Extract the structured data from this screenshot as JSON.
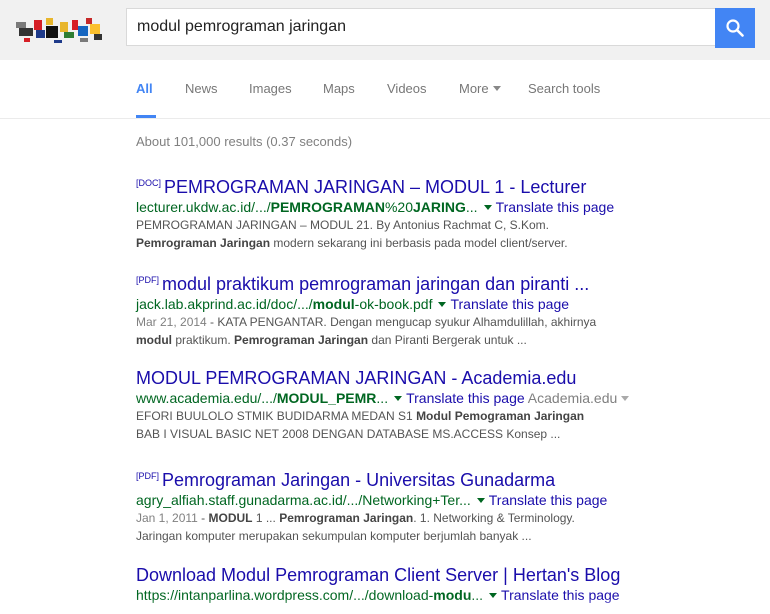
{
  "search": {
    "query": "modul pemrograman jaringan"
  },
  "tabs": [
    {
      "label": "All",
      "active": true
    },
    {
      "label": "News"
    },
    {
      "label": "Images"
    },
    {
      "label": "Maps"
    },
    {
      "label": "Videos"
    },
    {
      "label": "More"
    },
    {
      "label": "Search tools"
    }
  ],
  "stats": "About 101,000 results (0.37 seconds)",
  "translate_label": "Translate this page",
  "results": [
    {
      "filetype": "[DOC]",
      "title": "PEMROGRAMAN JARINGAN – MODUL 1 - Lecturer",
      "url_pre": "lecturer.ukdw.ac.id/.../",
      "url_bold": "PEMROGRAMAN",
      "url_mid": "%20",
      "url_bold2": "JARING",
      "url_post": "...",
      "snippet1": "PEMROGRAMAN JARINGAN – MODUL 21. By Antonius Rachmat C, S.Kom.",
      "snippet2_bold": "Pemrograman Jaringan",
      "snippet2_rest": " modern sekarang ini berbasis pada model client/server."
    },
    {
      "filetype": "[PDF]",
      "title": "modul praktikum pemrograman jaringan dan piranti ...",
      "url_pre": "jack.lab.akprind.ac.id/doc/.../",
      "url_bold": "modul",
      "url_post": "-ok-book.pdf",
      "date": "Mar 21, 2014",
      "snippet1_rest": " - KATA PENGANTAR. Dengan mengucap syukur Alhamdulillah, akhirnya",
      "snippet2_bold": "modul",
      "snippet2_mid": " praktikum. ",
      "snippet2_bold2": "Pemrograman Jaringan",
      "snippet2_rest": " dan Piranti Bergerak untuk ..."
    },
    {
      "title": "MODUL PEMROGRAMAN JARINGAN - Academia.edu",
      "url_pre": "www.academia.edu/.../",
      "url_bold": "MODUL_PEMR",
      "url_post": "...",
      "source": "Academia.edu",
      "snippet1_pre": "EFORI BUULOLO STMIK BUDIDARMA MEDAN S1 ",
      "snippet1_bold": "Modul Pemograman Jaringan",
      "snippet2": "BAB I VISUAL BASIC NET 2008 DENGAN DATABASE MS.ACCESS Konsep ..."
    },
    {
      "filetype": "[PDF]",
      "title": "Pemrograman Jaringan - Universitas Gunadarma",
      "url_pre": "agry_alfiah.staff.gunadarma.ac.id/.../Networking+Ter...",
      "date": "Jan 1, 2011",
      "snippet1_mid": " - ",
      "snippet1_bold": "MODUL",
      "snippet1_mid2": " 1 ... ",
      "snippet1_bold2": "Pemrograman Jaringan",
      "snippet1_rest": ". 1. Networking & Terminology.",
      "snippet2": "Jaringan komputer merupakan sekumpulan komputer berjumlah banyak ..."
    },
    {
      "title": "Download Modul Pemrograman Client Server | Hertan's Blog",
      "url_pre": "https://intanparlina.wordpress.com/.../download-",
      "url_bold": "modu",
      "url_post": "..."
    }
  ]
}
